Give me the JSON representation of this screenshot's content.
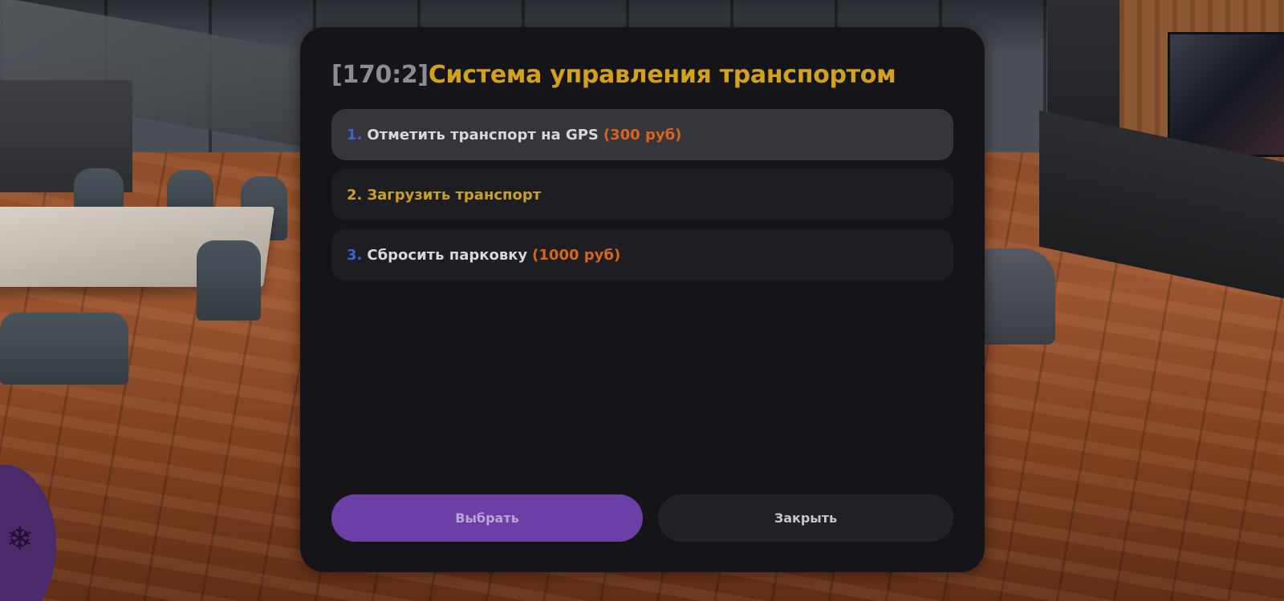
{
  "dialog": {
    "title_code": "[170:2]",
    "title_text": "Система управления транспортом",
    "items": [
      {
        "num": "1.",
        "label": "Отметить транспорт на GPS",
        "price": "(300 руб)",
        "selected": true
      },
      {
        "num": "2.",
        "label": "Загрузить транспорт",
        "price": "",
        "selected": false
      },
      {
        "num": "3.",
        "label": "Сбросить парковку",
        "price": "(1000 руб)",
        "selected": false
      }
    ],
    "buttons": {
      "select_label": "Выбрать",
      "close_label": "Закрыть"
    }
  },
  "colors": {
    "title_code": "#8c8c93",
    "title_text": "#d2a21c",
    "item_number": "#3d63d6",
    "price": "#d6651e",
    "select_button": "#6b3fa5",
    "dialog_bg": "#151519"
  }
}
